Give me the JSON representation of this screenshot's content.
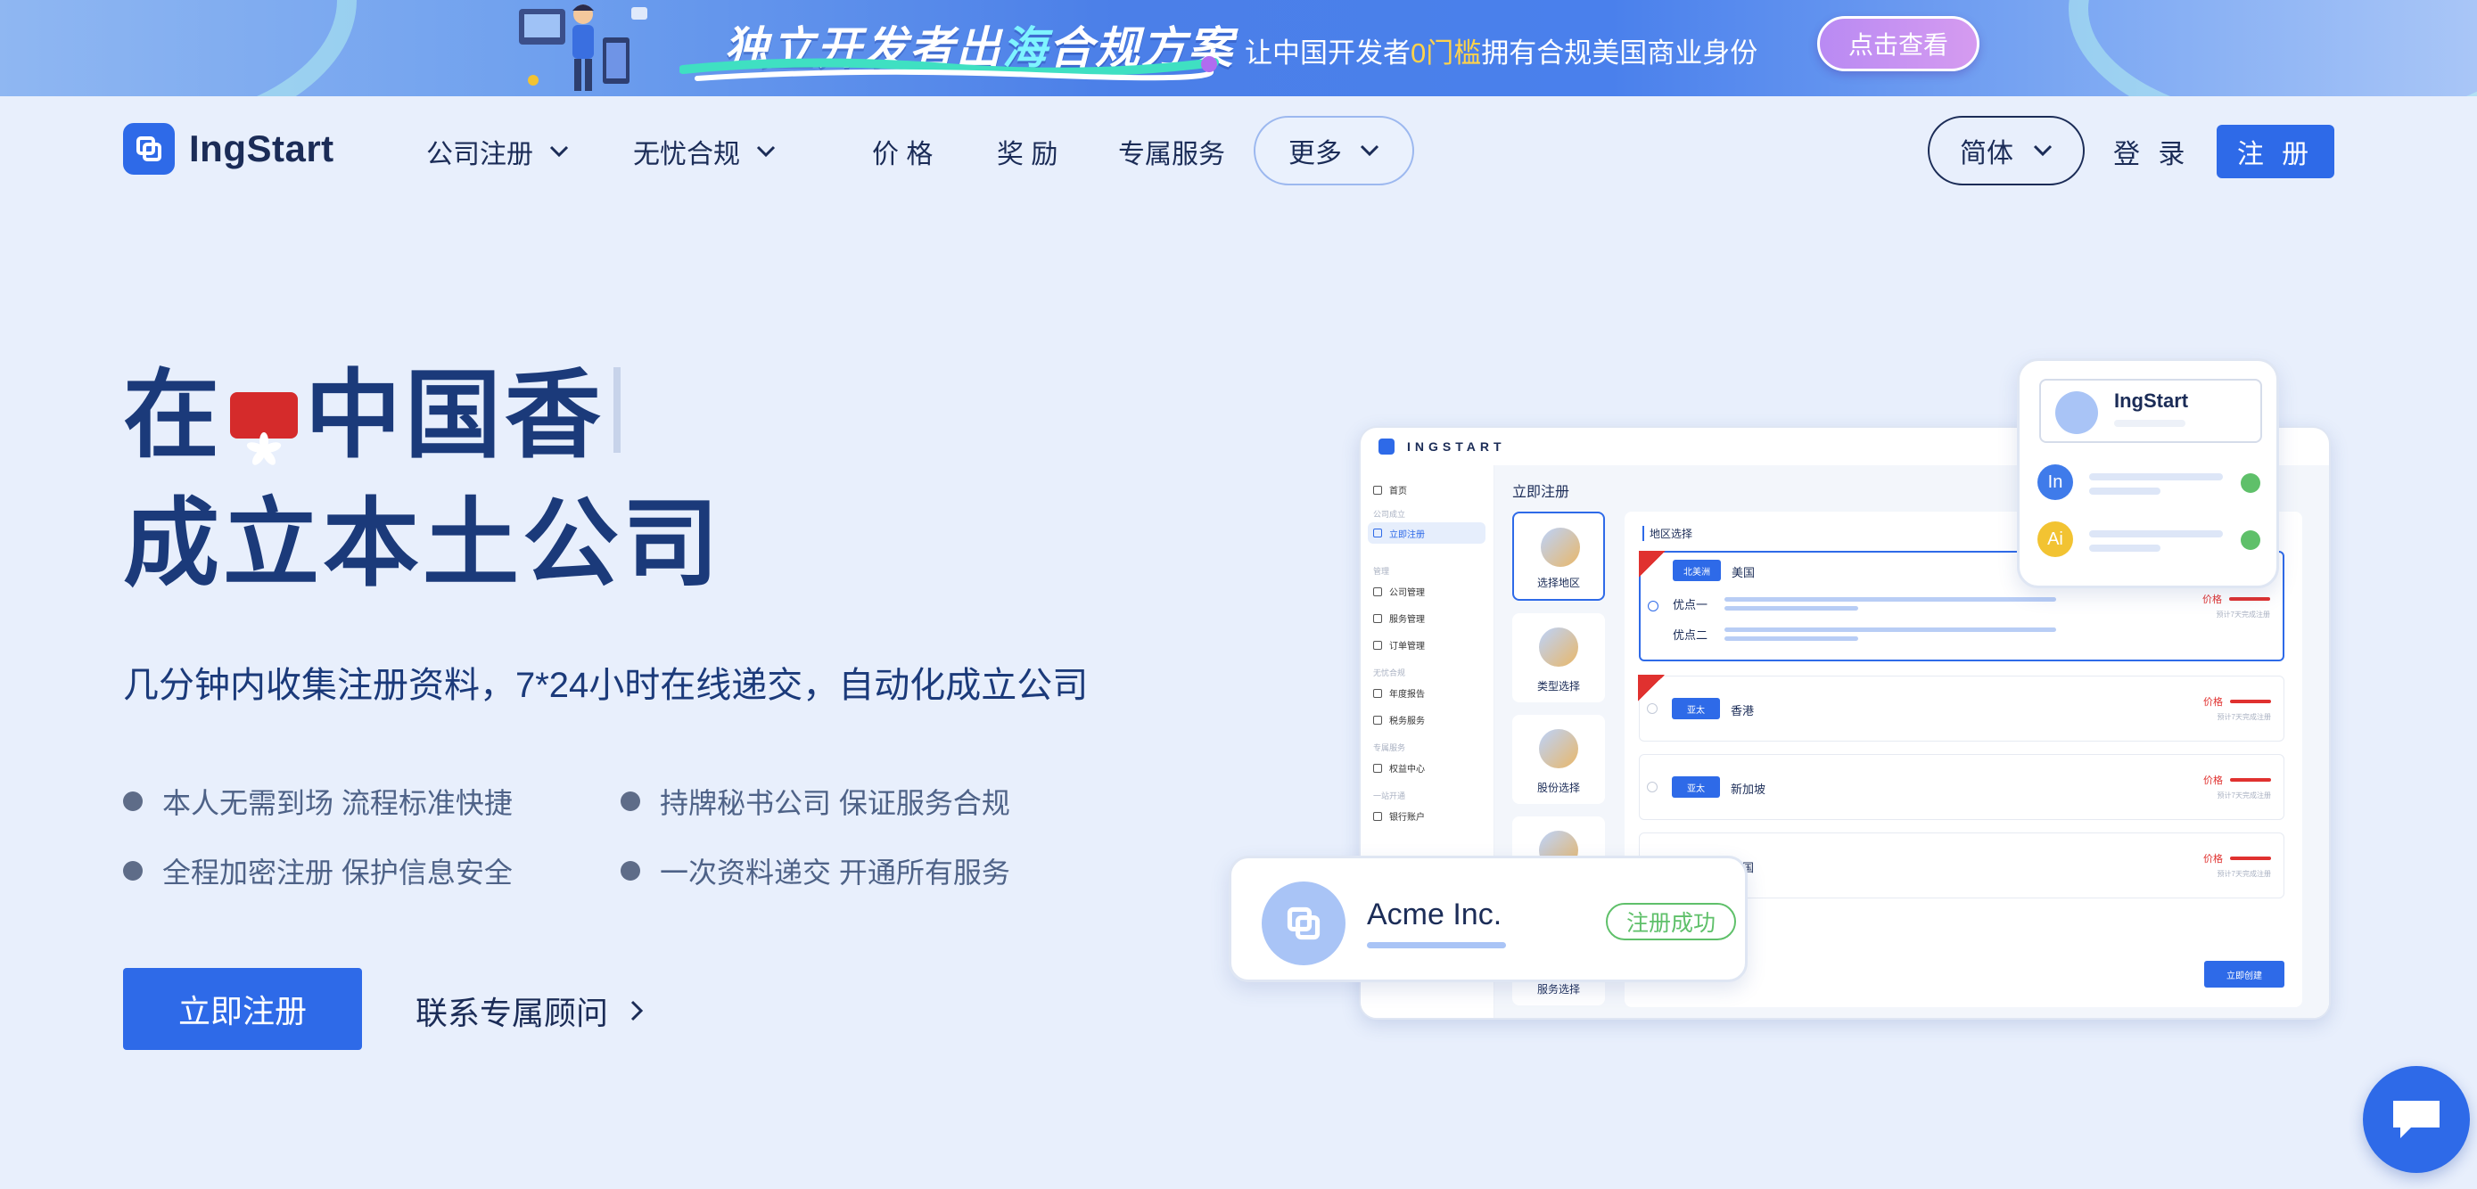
{
  "promo": {
    "title_prefix": "独立开发者出",
    "title_highlight": "海",
    "title_suffix": "合规方案",
    "sub_prefix": "让中国开发者",
    "sub_highlight": "0门槛",
    "sub_suffix": "拥有合规美国商业身份",
    "cta_label": "点击查看"
  },
  "nav": {
    "brand": "IngStart",
    "items": [
      {
        "label": "公司注册",
        "dropdown": true
      },
      {
        "label": "无忧合规",
        "dropdown": true
      },
      {
        "label": "价 格",
        "dropdown": false
      },
      {
        "label": "奖 励",
        "dropdown": false
      },
      {
        "label": "专属服务",
        "dropdown": false
      }
    ],
    "more_label": "更多",
    "language_label": "简体",
    "login_label": "登 录",
    "signup_label": "注 册"
  },
  "hero": {
    "line1_prefix": "在",
    "line1_suffix": "中国香",
    "line2": "成立本土公司",
    "lead": "几分钟内收集注册资料，7*24小时在线递交，自动化成立公司",
    "features": [
      "本人无需到场 流程标准快捷",
      "持牌秘书公司 保证服务合规",
      "全程加密注册 保护信息安全",
      "一次资料递交 开通所有服务"
    ],
    "primary_cta": "立即注册",
    "secondary_cta": "联系专属顾问"
  },
  "mock": {
    "brand": "INGSTART",
    "sidebar": {
      "home": "首页",
      "group_incorp": "公司成立",
      "register_now": "立即注册",
      "group_manage": "管理",
      "company_mgmt": "公司管理",
      "service_mgmt": "服务管理",
      "order_mgmt": "订单管理",
      "group_compliance": "无忧合规",
      "annual_report": "年度报告",
      "tax_service": "税务服务",
      "group_exclusive": "专属服务",
      "rights_center": "权益中心",
      "group_onestop": "一站开通",
      "bank_account": "银行账户"
    },
    "content_title": "立即注册",
    "steps": [
      "选择地区",
      "类型选择",
      "股份选择",
      "服务选择"
    ],
    "panel_title": "地区选择",
    "regions": [
      {
        "tag": "北美洲",
        "country": "美国",
        "options": [
          "优点一",
          "优点二"
        ]
      },
      {
        "tag": "亚太",
        "country": "香港"
      },
      {
        "tag": "亚太",
        "country": "新加坡"
      },
      {
        "tag": "",
        "country": "英国"
      }
    ],
    "price_label": "价格",
    "price_note": "预计7天完成注册",
    "create_label": "立即创建"
  },
  "card_top": {
    "title": "IngStart",
    "rows": [
      {
        "badge": "In",
        "color": "#3f7bea"
      },
      {
        "badge": "Ai",
        "color": "#f2c332"
      }
    ]
  },
  "card_bottom": {
    "company": "Acme Inc.",
    "status": "注册成功"
  },
  "colors": {
    "primary": "#2e6ae8",
    "heading": "#1b3a7a",
    "success": "#5fc06a",
    "price": "#e0312f"
  }
}
